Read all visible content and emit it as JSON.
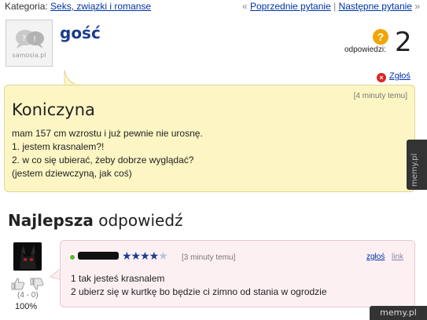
{
  "topbar": {
    "category_label": "Kategoria:",
    "category_link": "Seks, związki i romanse",
    "prev_arrow": "«",
    "prev_link": "Poprzednie pytanie",
    "separator": "|",
    "next_link": "Następne pytanie",
    "next_arrow": "»"
  },
  "asker": {
    "avatar_brand": "samosia.pl",
    "name": "gość"
  },
  "answers": {
    "label": "odpowiedzi:",
    "count": "2",
    "icon": "question-mark-icon",
    "icon_color": "#f0a500"
  },
  "report": {
    "icon": "close-icon",
    "label": "Zgłoś"
  },
  "question": {
    "time": "[4 minuty temu]",
    "title": "Koniczyna",
    "lines": [
      "mam 157 cm wzrostu i już pewnie nie urosnę.",
      "1. jestem krasnalem?!",
      "2. w co się ubierać, żeby dobrze wyglądać?",
      "(jestem dziewczyną, jak coś)"
    ],
    "background": "#fdf6c4"
  },
  "best_answer": {
    "heading_bold": "Najlepsza",
    "heading_rest": " odpowiedź",
    "rating": {
      "filled": "★★★★",
      "empty": "★",
      "value": 3.5,
      "max": 5
    },
    "time": "[3 minuty temu]",
    "report_label": "zgłoś",
    "link_label": "link",
    "lines": [
      "1 tak jesteś krasnalem",
      "2 ubierz się w kurtkę bo będzie ci zimno od stania w ogrodzie"
    ],
    "votes": {
      "score": "(4 - 0)",
      "percent": "100%",
      "up_icon": "thumb-up-icon",
      "down_icon": "thumb-down-icon"
    },
    "status_color": "#5cb82e",
    "background": "#fdf0f3"
  },
  "watermark": {
    "side": "memy.pl",
    "bottom": "memy.pl"
  }
}
